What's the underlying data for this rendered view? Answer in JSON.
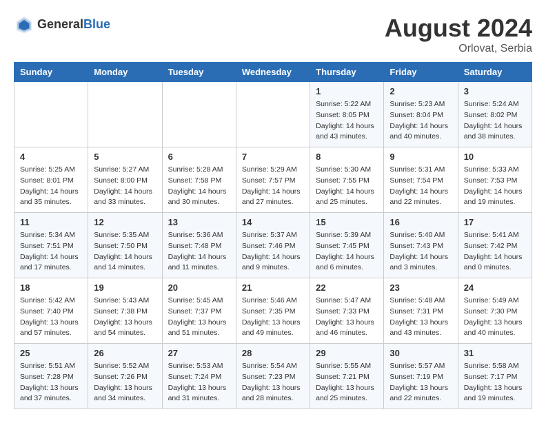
{
  "header": {
    "logo_general": "General",
    "logo_blue": "Blue",
    "month_year": "August 2024",
    "location": "Orlovat, Serbia"
  },
  "days_of_week": [
    "Sunday",
    "Monday",
    "Tuesday",
    "Wednesday",
    "Thursday",
    "Friday",
    "Saturday"
  ],
  "weeks": [
    {
      "days": [
        {
          "number": "",
          "info": ""
        },
        {
          "number": "",
          "info": ""
        },
        {
          "number": "",
          "info": ""
        },
        {
          "number": "",
          "info": ""
        },
        {
          "number": "1",
          "info": "Sunrise: 5:22 AM\nSunset: 8:05 PM\nDaylight: 14 hours\nand 43 minutes."
        },
        {
          "number": "2",
          "info": "Sunrise: 5:23 AM\nSunset: 8:04 PM\nDaylight: 14 hours\nand 40 minutes."
        },
        {
          "number": "3",
          "info": "Sunrise: 5:24 AM\nSunset: 8:02 PM\nDaylight: 14 hours\nand 38 minutes."
        }
      ]
    },
    {
      "days": [
        {
          "number": "4",
          "info": "Sunrise: 5:25 AM\nSunset: 8:01 PM\nDaylight: 14 hours\nand 35 minutes."
        },
        {
          "number": "5",
          "info": "Sunrise: 5:27 AM\nSunset: 8:00 PM\nDaylight: 14 hours\nand 33 minutes."
        },
        {
          "number": "6",
          "info": "Sunrise: 5:28 AM\nSunset: 7:58 PM\nDaylight: 14 hours\nand 30 minutes."
        },
        {
          "number": "7",
          "info": "Sunrise: 5:29 AM\nSunset: 7:57 PM\nDaylight: 14 hours\nand 27 minutes."
        },
        {
          "number": "8",
          "info": "Sunrise: 5:30 AM\nSunset: 7:55 PM\nDaylight: 14 hours\nand 25 minutes."
        },
        {
          "number": "9",
          "info": "Sunrise: 5:31 AM\nSunset: 7:54 PM\nDaylight: 14 hours\nand 22 minutes."
        },
        {
          "number": "10",
          "info": "Sunrise: 5:33 AM\nSunset: 7:53 PM\nDaylight: 14 hours\nand 19 minutes."
        }
      ]
    },
    {
      "days": [
        {
          "number": "11",
          "info": "Sunrise: 5:34 AM\nSunset: 7:51 PM\nDaylight: 14 hours\nand 17 minutes."
        },
        {
          "number": "12",
          "info": "Sunrise: 5:35 AM\nSunset: 7:50 PM\nDaylight: 14 hours\nand 14 minutes."
        },
        {
          "number": "13",
          "info": "Sunrise: 5:36 AM\nSunset: 7:48 PM\nDaylight: 14 hours\nand 11 minutes."
        },
        {
          "number": "14",
          "info": "Sunrise: 5:37 AM\nSunset: 7:46 PM\nDaylight: 14 hours\nand 9 minutes."
        },
        {
          "number": "15",
          "info": "Sunrise: 5:39 AM\nSunset: 7:45 PM\nDaylight: 14 hours\nand 6 minutes."
        },
        {
          "number": "16",
          "info": "Sunrise: 5:40 AM\nSunset: 7:43 PM\nDaylight: 14 hours\nand 3 minutes."
        },
        {
          "number": "17",
          "info": "Sunrise: 5:41 AM\nSunset: 7:42 PM\nDaylight: 14 hours\nand 0 minutes."
        }
      ]
    },
    {
      "days": [
        {
          "number": "18",
          "info": "Sunrise: 5:42 AM\nSunset: 7:40 PM\nDaylight: 13 hours\nand 57 minutes."
        },
        {
          "number": "19",
          "info": "Sunrise: 5:43 AM\nSunset: 7:38 PM\nDaylight: 13 hours\nand 54 minutes."
        },
        {
          "number": "20",
          "info": "Sunrise: 5:45 AM\nSunset: 7:37 PM\nDaylight: 13 hours\nand 51 minutes."
        },
        {
          "number": "21",
          "info": "Sunrise: 5:46 AM\nSunset: 7:35 PM\nDaylight: 13 hours\nand 49 minutes."
        },
        {
          "number": "22",
          "info": "Sunrise: 5:47 AM\nSunset: 7:33 PM\nDaylight: 13 hours\nand 46 minutes."
        },
        {
          "number": "23",
          "info": "Sunrise: 5:48 AM\nSunset: 7:31 PM\nDaylight: 13 hours\nand 43 minutes."
        },
        {
          "number": "24",
          "info": "Sunrise: 5:49 AM\nSunset: 7:30 PM\nDaylight: 13 hours\nand 40 minutes."
        }
      ]
    },
    {
      "days": [
        {
          "number": "25",
          "info": "Sunrise: 5:51 AM\nSunset: 7:28 PM\nDaylight: 13 hours\nand 37 minutes."
        },
        {
          "number": "26",
          "info": "Sunrise: 5:52 AM\nSunset: 7:26 PM\nDaylight: 13 hours\nand 34 minutes."
        },
        {
          "number": "27",
          "info": "Sunrise: 5:53 AM\nSunset: 7:24 PM\nDaylight: 13 hours\nand 31 minutes."
        },
        {
          "number": "28",
          "info": "Sunrise: 5:54 AM\nSunset: 7:23 PM\nDaylight: 13 hours\nand 28 minutes."
        },
        {
          "number": "29",
          "info": "Sunrise: 5:55 AM\nSunset: 7:21 PM\nDaylight: 13 hours\nand 25 minutes."
        },
        {
          "number": "30",
          "info": "Sunrise: 5:57 AM\nSunset: 7:19 PM\nDaylight: 13 hours\nand 22 minutes."
        },
        {
          "number": "31",
          "info": "Sunrise: 5:58 AM\nSunset: 7:17 PM\nDaylight: 13 hours\nand 19 minutes."
        }
      ]
    }
  ]
}
